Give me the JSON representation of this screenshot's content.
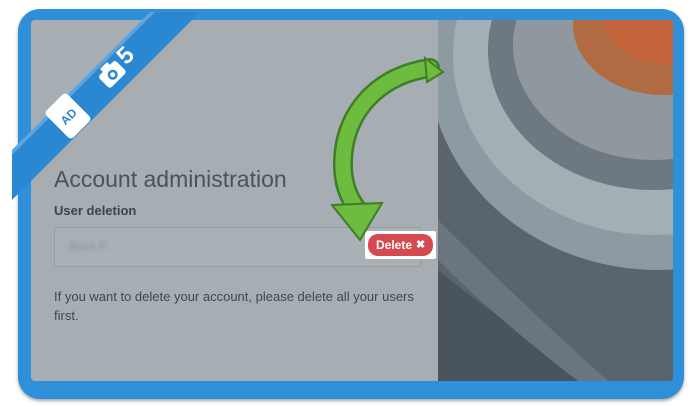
{
  "account": {
    "title": "Account administration",
    "section_label": "User deletion",
    "user_name": "Bass P.",
    "delete_label": "Delete",
    "help_text": "If you want to delete your account, please delete all your users first."
  },
  "badge": {
    "step_number": "5",
    "logo_text": "AD"
  },
  "icons": {
    "delete": "close-icon",
    "step_camera": "camera-icon",
    "logo": "document-badge-icon",
    "pointer_arrow": "curved-arrow-icon"
  },
  "colors": {
    "frame_blue": "#2f8fd8",
    "delete_red": "#d64a4f",
    "arrow_green": "#6dbb3f"
  }
}
